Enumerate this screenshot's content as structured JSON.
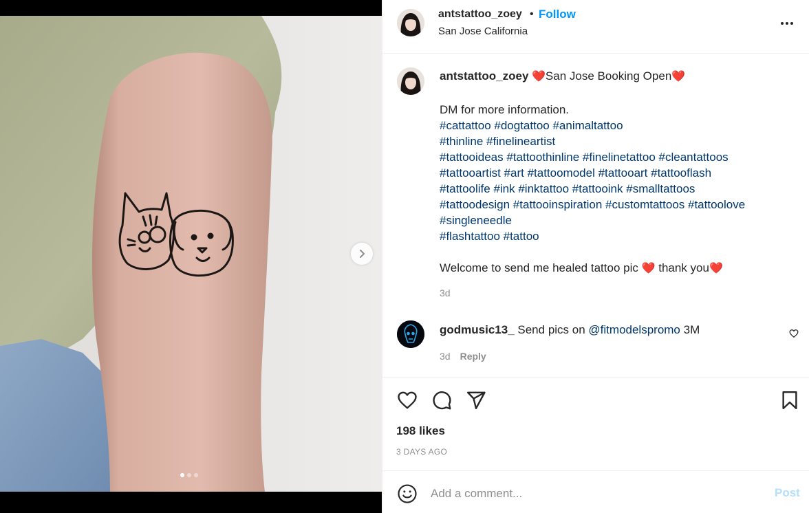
{
  "post": {
    "username": "antstattoo_zoey",
    "separator": "•",
    "follow_label": "Follow",
    "location": "San Jose California",
    "more_icon": "more-horizontal-icon"
  },
  "caption": {
    "username": "antstattoo_zoey",
    "title_heart_left": "❤️",
    "title_text": "San Jose Booking Open",
    "title_heart_right": "❤️",
    "dm_line": "DM for more information.",
    "hashtag_lines": [
      "#cattattoo #dogtattoo #animaltattoo",
      "#thinline #finelineartist",
      "#tattooideas #tattoothinline #finelinetattoo #cleantattoos",
      "#tattooartist #art #tattoomodel #tattooart #tattooflash",
      "#tattoolife #ink #inktattoo #tattooink #smalltattoos",
      "#tattoodesign #tattooinspiration #customtattoos #tattoolove",
      "#singleneedle",
      "#flashtattoo #tattoo"
    ],
    "welcome_text": "Welcome to send me healed tattoo pic",
    "welcome_heart": "❤️",
    "thanks_text": "thank you",
    "thanks_heart": "❤️",
    "time": "3d"
  },
  "comment": {
    "username": "godmusic13_",
    "text_before": "Send pics on",
    "mention": "@fitmodelspromo",
    "text_after": "3M",
    "time": "3d",
    "reply_label": "Reply"
  },
  "actions": {
    "icons": [
      "heart-icon",
      "comment-icon",
      "share-icon",
      "bookmark-icon"
    ],
    "likes": "198 likes",
    "date": "3 DAYS AGO"
  },
  "composer": {
    "placeholder": "Add a comment...",
    "post_label": "Post"
  },
  "media": {
    "slide_count": 3,
    "active_slide": 1,
    "next_icon": "chevron-right-icon"
  },
  "colors": {
    "link_blue": "#0095f6",
    "hashtag": "#00376b",
    "secondary_text": "#8e8e8e",
    "heart_red": "#ed1c24",
    "post_disabled": "#b2dffc"
  }
}
